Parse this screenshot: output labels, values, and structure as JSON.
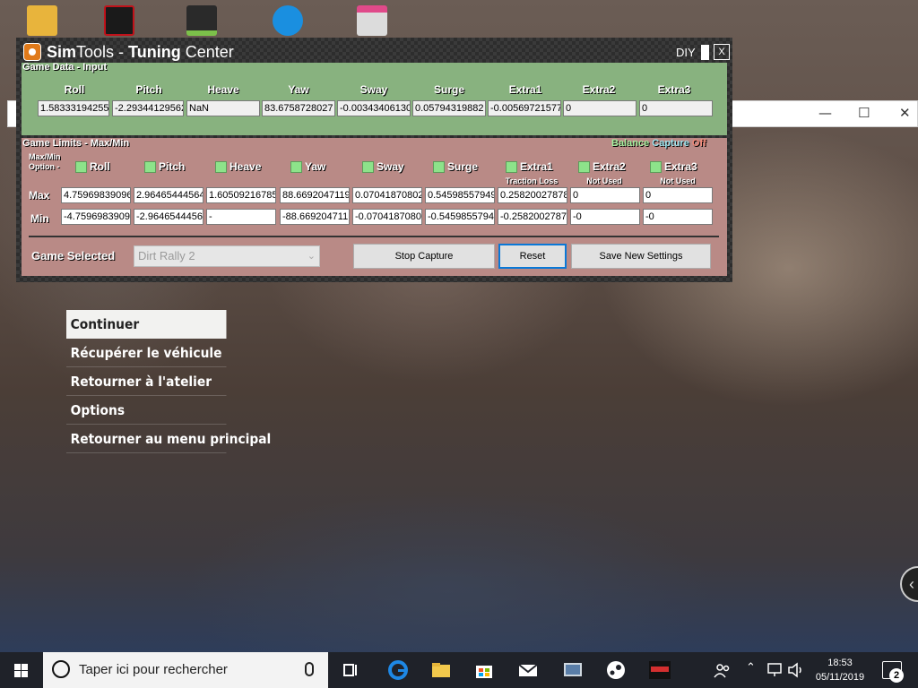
{
  "desktop": {
    "icons": [
      {
        "name": "user-folder-icon",
        "color": "#e8b43c"
      },
      {
        "name": "assetto-corsa-icon",
        "color": "#c0121a"
      },
      {
        "name": "app-stripes-icon",
        "color": "#2a2a2a"
      },
      {
        "name": "uplay-icon",
        "color": "#1a8fe0"
      },
      {
        "name": "printer-icon",
        "color": "#dcdcdc"
      }
    ]
  },
  "simtools": {
    "title_sim": "Sim",
    "title_tools": "Tools - ",
    "title_tuning": "Tuning",
    "title_center": " Center",
    "diy": "DIY",
    "close": "X",
    "game_data": {
      "title": "Game Data - Input",
      "columns": [
        "Roll",
        "Pitch",
        "Heave",
        "Yaw",
        "Sway",
        "Surge",
        "Extra1",
        "Extra2",
        "Extra3"
      ],
      "values": [
        "1.58333194255",
        "-2.29344129562",
        "NaN",
        "83.6758728027",
        "-0.00343406130",
        "0.05794319882",
        "-0.00569721577",
        "0",
        "0"
      ]
    },
    "game_limits": {
      "title": "Game Limits - Max/Min",
      "balance_label": "Balance",
      "capture_label": "Capture",
      "capture_state": "Off",
      "option_line1": "Max/Min",
      "option_line2": "Option -",
      "options": [
        "Roll",
        "Pitch",
        "Heave",
        "Yaw",
        "Sway",
        "Surge",
        "Extra1",
        "Extra2",
        "Extra3"
      ],
      "sublabels": [
        "",
        "",
        "",
        "",
        "",
        "",
        "Traction Loss",
        "Not Used",
        "Not Used"
      ],
      "max_label": "Max",
      "min_label": "Min",
      "max_values": [
        "4.75969839096",
        "2.96465444564",
        "1.60509216785",
        "88.6692047119",
        "0.07041870802",
        "0.54598557949",
        "0.25820027878",
        "0",
        "0"
      ],
      "min_values": [
        "-4.7596983909",
        "-2.9646544456",
        "-",
        "-88.669204711",
        "-0.0704187080",
        "-0.5459855794",
        "-0.2582002787",
        "-0",
        "-0"
      ]
    },
    "game_selected_label": "Game Selected",
    "game_selected_value": "Dirt Rally 2",
    "stop_capture": "Stop Capture",
    "reset": "Reset",
    "save_settings": "Save New Settings"
  },
  "game_menu": {
    "items": [
      "Continuer",
      "Récupérer le véhicule",
      "Retourner à l'atelier",
      "Options",
      "Retourner au menu principal"
    ],
    "active_index": 0
  },
  "background_window": {
    "minimize": "—",
    "maximize": "☐",
    "close": "✕"
  },
  "taskbar": {
    "search_placeholder": "Taper ici pour rechercher",
    "time": "18:53",
    "date": "05/11/2019",
    "notification_count": "2",
    "pinned": [
      "task-view-icon",
      "edge-icon",
      "file-explorer-icon",
      "store-icon",
      "mail-icon",
      "simtools-taskbar-icon",
      "steam-icon",
      "dirt-rally-icon"
    ]
  }
}
